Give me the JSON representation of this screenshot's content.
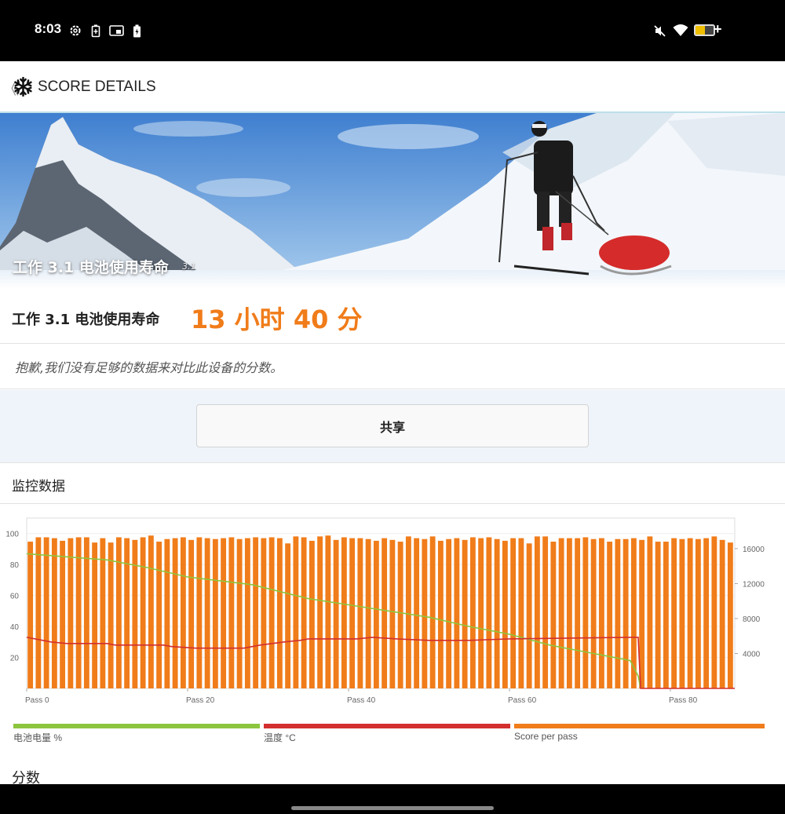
{
  "status_bar": {
    "time": "8:03",
    "battery_level": 0.5,
    "icons": [
      "settings-gear-icon",
      "battery-saver-icon",
      "cast-icon",
      "charging-icon",
      "mute-icon",
      "wifi-icon",
      "battery-icon"
    ]
  },
  "app_bar": {
    "back_label": "《",
    "title": "SCORE DETAILS",
    "icon": "snowflake-icon"
  },
  "hero": {
    "title": "工作 3.1 电池使用寿命",
    "version": "3.1"
  },
  "result": {
    "label": "工作 3.1 电池使用寿命",
    "value": "13 小时 40 分",
    "accent_color": "#f07c1a"
  },
  "notice": {
    "text": "抱歉,我们没有足够的数据来对比此设备的分数。"
  },
  "share": {
    "label": "共享"
  },
  "monitor": {
    "title": "监控数据"
  },
  "chart_data": {
    "type": "bar",
    "x_labels": [
      "Pass 0",
      "Pass 20",
      "Pass 40",
      "Pass 60",
      "Pass 80"
    ],
    "x_ticks": [
      0,
      20,
      40,
      60,
      80
    ],
    "xlim": [
      0,
      88
    ],
    "left_axis": {
      "ticks": [
        20,
        40,
        60,
        80,
        100
      ],
      "ylim": [
        0,
        110
      ]
    },
    "right_axis": {
      "ticks": [
        4000,
        8000,
        12000,
        16000
      ],
      "ylim": [
        0,
        19500
      ]
    },
    "grid": true,
    "legend_position": "bottom",
    "series": [
      {
        "name": "电池电量 %",
        "color": "#8cc63f",
        "axis": "left",
        "type": "line",
        "x": [
          0,
          10,
          15,
          20,
          28,
          35,
          40,
          50,
          55,
          60,
          65,
          70,
          75,
          76,
          76.3
        ],
        "values": [
          87,
          83,
          78,
          72,
          67,
          58,
          54,
          46,
          40,
          35,
          28,
          23,
          18,
          8,
          0
        ]
      },
      {
        "name": "温度 °C",
        "color": "#d32f2f",
        "axis": "left",
        "type": "line",
        "x": [
          0,
          2,
          3,
          5,
          10,
          11,
          17,
          18,
          21,
          27,
          29,
          32,
          34,
          35,
          37,
          41,
          43,
          46,
          50,
          52,
          55,
          60,
          75,
          76,
          76.3,
          88
        ],
        "values": [
          33,
          31,
          30,
          29,
          29,
          28,
          28,
          27,
          26,
          26,
          28,
          30,
          31,
          32,
          32,
          32,
          33,
          32,
          31,
          31,
          31,
          32,
          33,
          33,
          0,
          0
        ]
      },
      {
        "name": "Score per pass",
        "color": "#f07c1a",
        "axis": "right",
        "type": "bar",
        "values": [
          16800,
          17300,
          17300,
          17200,
          16900,
          17200,
          17300,
          17300,
          16700,
          17200,
          16700,
          17300,
          17200,
          17000,
          17300,
          17500,
          16800,
          17100,
          17200,
          17300,
          17000,
          17300,
          17200,
          17100,
          17200,
          17300,
          17100,
          17200,
          17300,
          17200,
          17300,
          17200,
          16600,
          17400,
          17300,
          16900,
          17400,
          17500,
          17000,
          17300,
          17200,
          17200,
          17100,
          16900,
          17200,
          17000,
          16800,
          17400,
          17200,
          17100,
          17400,
          16900,
          17100,
          17200,
          17000,
          17300,
          17200,
          17300,
          17100,
          16900,
          17200,
          17200,
          16600,
          17400,
          17400,
          16800,
          17200,
          17200,
          17200,
          17300,
          17100,
          17200,
          16800,
          17100,
          17100,
          17200,
          17000,
          17400,
          16800,
          16800,
          17200,
          17100,
          17200,
          17100,
          17200,
          17400,
          17000,
          16700
        ]
      }
    ]
  },
  "score_section": {
    "title": "分数"
  }
}
